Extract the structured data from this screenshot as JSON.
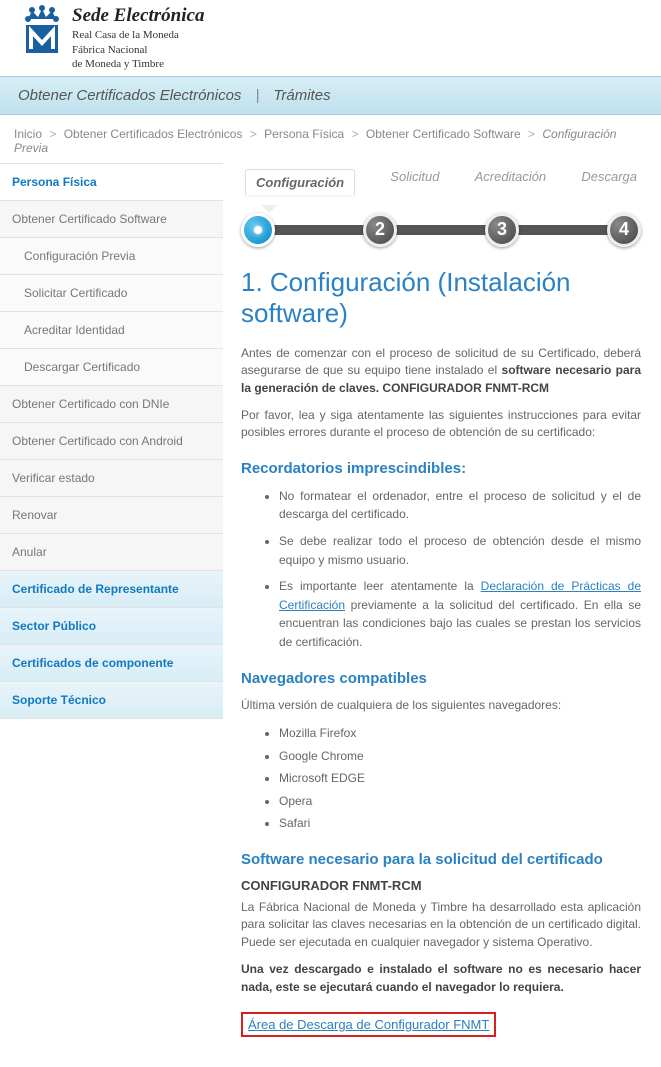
{
  "header": {
    "title": "Sede Electrónica",
    "sub1": "Real Casa de la Moneda",
    "sub2": "Fábrica Nacional",
    "sub3": "de Moneda y Timbre"
  },
  "navbar": {
    "item1": "Obtener Certificados Electrónicos",
    "item2": "Trámites"
  },
  "breadcrumb": {
    "items": [
      "Inicio",
      "Obtener Certificados Electrónicos",
      "Persona Física",
      "Obtener Certificado Software"
    ],
    "current": "Configuración Previa",
    "sep": ">"
  },
  "sidebar": {
    "persona": "Persona Física",
    "ocs": "Obtener Certificado Software",
    "conf": "Configuración Previa",
    "sol": "Solicitar Certificado",
    "acr": "Acreditar Identidad",
    "desc": "Descargar Certificado",
    "dnie": "Obtener Certificado con DNIe",
    "android": "Obtener Certificado con Android",
    "verificar": "Verificar estado",
    "renovar": "Renovar",
    "anular": "Anular",
    "rep": "Certificado de Representante",
    "sector": "Sector Público",
    "comp": "Certificados de componente",
    "soporte": "Soporte Técnico"
  },
  "stepper": {
    "s1": "Configuración",
    "s2": "Solicitud",
    "s3": "Acreditación",
    "s4": "Descarga",
    "n2": "2",
    "n3": "3",
    "n4": "4"
  },
  "content": {
    "h1": "1. Configuración (Instalación software)",
    "p1a": "Antes de comenzar con el proceso de solicitud de su Certificado, deberá asegurarse de que su equipo tiene instalado el ",
    "p1b": "software necesario para la generación de claves. CONFIGURADOR FNMT-RCM",
    "p2": "Por favor, lea y siga atentamente las siguientes instrucciones para evitar posibles errores durante el proceso de obtención de su certificado:",
    "h2a": "Recordatorios imprescindibles:",
    "li1": "No formatear el ordenador, entre el proceso de solicitud y el de descarga del certificado.",
    "li2": "Se debe realizar todo el proceso de obtención desde el mismo equipo y mismo usuario.",
    "li3a": "Es importante leer atentamente la ",
    "li3link": "Declaración de Prácticas de Certificación",
    "li3b": " previamente a la solicitud del certificado. En ella se encuentran las condiciones bajo las cuales se prestan los servicios de certificación.",
    "h2b": "Navegadores compatibles",
    "p3": "Última versión de cualquiera de los siguientes navegadores:",
    "browsers": [
      "Mozilla Firefox",
      "Google Chrome",
      "Microsoft EDGE",
      "Opera",
      "Safari"
    ],
    "h2c": "Software necesario para la solicitud del certificado",
    "h3": "CONFIGURADOR FNMT-RCM",
    "p4": "La Fábrica Nacional de Moneda y Timbre ha desarrollado esta aplicación para solicitar las claves necesarias en la obtención de un certificado digital. Puede ser ejecutada en cualquier navegador y sistema Operativo.",
    "p5": "Una vez descargado e instalado el software no es necesario hacer nada, este se ejecutará cuando el navegador lo requiera.",
    "download": "Área de Descarga de Configurador FNMT"
  }
}
